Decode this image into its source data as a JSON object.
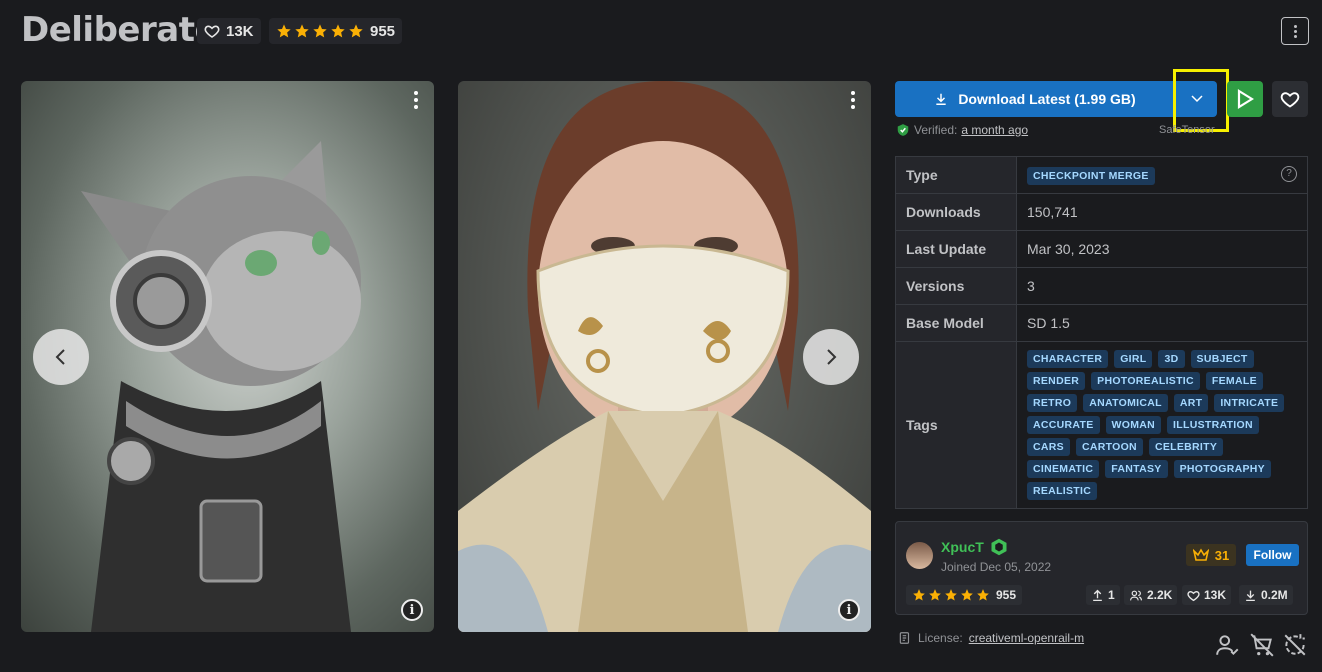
{
  "header": {
    "title": "Deliberate",
    "likes": "13K",
    "rating_count": "955"
  },
  "gallery": {
    "nav_prev": "‹",
    "nav_next": "›"
  },
  "download": {
    "label": "Download Latest (1.99 GB)",
    "verified_label": "Verified:",
    "verified_time": "a month ago",
    "format_hint": "SafeTensor"
  },
  "details": {
    "rows": [
      {
        "key": "Type",
        "value": "CHECKPOINT MERGE"
      },
      {
        "key": "Downloads",
        "value": "150,741"
      },
      {
        "key": "Last Update",
        "value": "Mar 30, 2023"
      },
      {
        "key": "Versions",
        "value": "3"
      },
      {
        "key": "Base Model",
        "value": "SD 1.5"
      },
      {
        "key": "Tags"
      }
    ],
    "tags": [
      "CHARACTER",
      "GIRL",
      "3D",
      "SUBJECT",
      "RENDER",
      "PHOTOREALISTIC",
      "FEMALE",
      "RETRO",
      "ANATOMICAL",
      "ART",
      "INTRICATE",
      "ACCURATE",
      "WOMAN",
      "ILLUSTRATION",
      "CARS",
      "CARTOON",
      "CELEBRITY",
      "CINEMATIC",
      "FANTASY",
      "PHOTOGRAPHY",
      "REALISTIC"
    ]
  },
  "creator": {
    "name": "XpucT",
    "joined": "Joined Dec 05, 2022",
    "rank": "31",
    "follow": "Follow",
    "rating_count": "955",
    "uploads": "1",
    "followers": "2.2K",
    "likes": "13K",
    "downloads": "0.2M"
  },
  "license": {
    "label": "License:",
    "name": "creativeml-openrail-m"
  },
  "colors": {
    "accent": "#1971c2",
    "play": "#2f9e44",
    "star": "#fab005",
    "highlight": "#f7f000"
  }
}
